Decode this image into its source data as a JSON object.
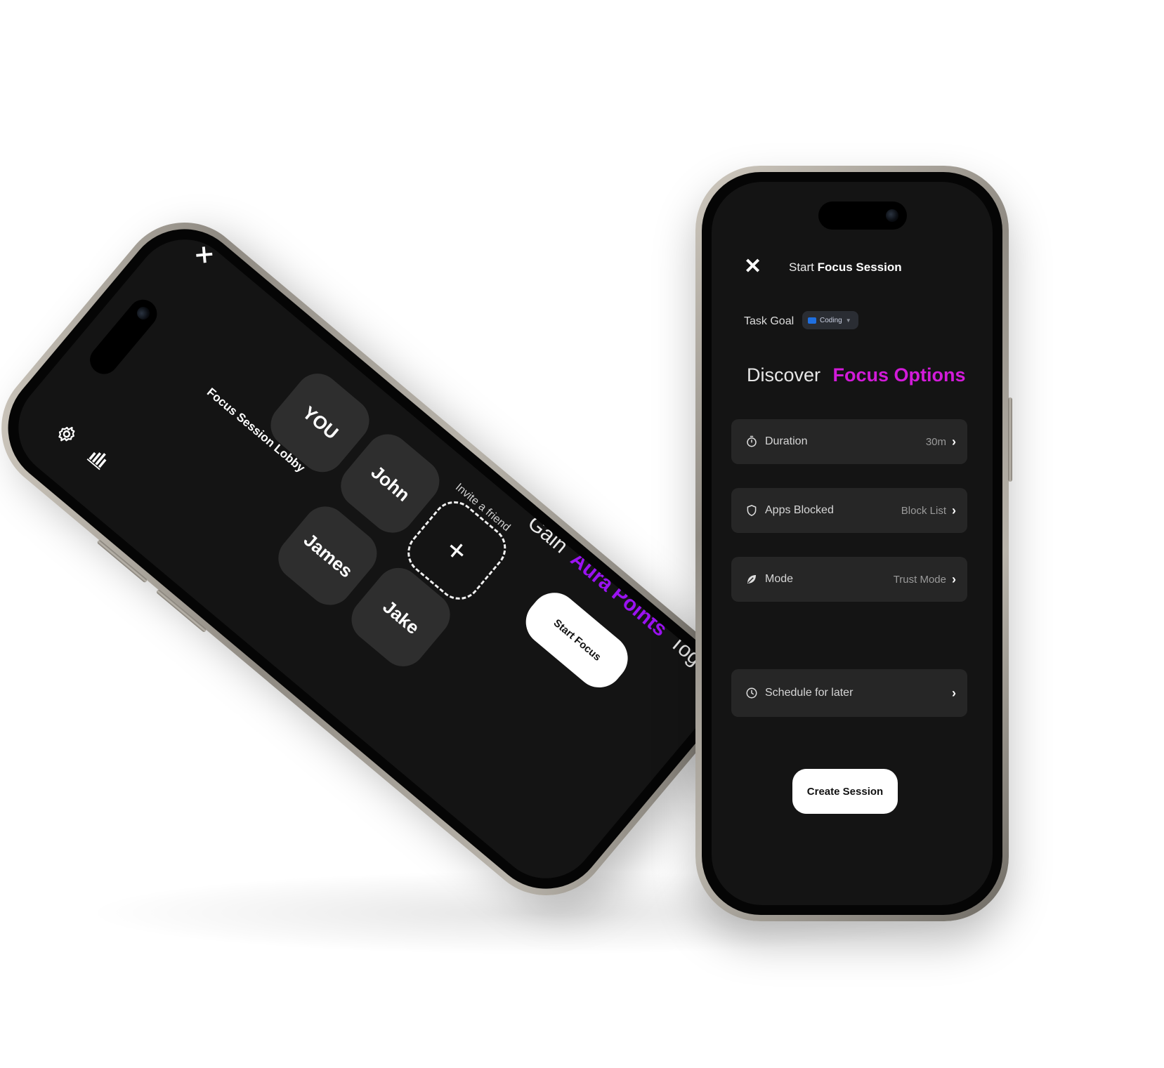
{
  "colors": {
    "screen_bg": "#141414",
    "card_bg": "#262626",
    "tile_bg": "#2e2e2e",
    "accent_magenta": "#d21bd9",
    "accent_purple": "#9b12f2",
    "chip_blue": "#1f6fe0",
    "button_bg": "#ffffff"
  },
  "lobby": {
    "title": "Focus Session Lobby",
    "close_icon": "close-icon",
    "settings_icon": "gear-icon",
    "stats_icon": "bar-chart-icon",
    "participants": [
      {
        "name": "YOU"
      },
      {
        "name": "John"
      },
      {
        "name": "James"
      },
      {
        "name": "Jake"
      }
    ],
    "invite": {
      "label": "Invite a friend",
      "icon": "plus-icon"
    },
    "tagline": {
      "prefix": "Gain",
      "highlight": "Aura Points",
      "suffix": "Together"
    },
    "start_button": "Start Focus"
  },
  "session": {
    "title_prefix": "Start",
    "title_bold": "Focus Session",
    "close_icon": "close-icon",
    "task_goal": {
      "label": "Task Goal",
      "value": "Coding",
      "icon": "laptop-icon"
    },
    "discover": {
      "prefix": "Discover",
      "highlight": "Focus Options"
    },
    "options": [
      {
        "label": "Duration",
        "value": "30m",
        "icon": "timer-icon"
      },
      {
        "label": "Apps Blocked",
        "value": "Block List",
        "icon": "shield-icon"
      },
      {
        "label": "Mode",
        "value": "Trust Mode",
        "icon": "leaf-icon"
      }
    ],
    "schedule": {
      "label": "Schedule for later",
      "icon": "clock-icon"
    },
    "create_button": "Create Session"
  }
}
